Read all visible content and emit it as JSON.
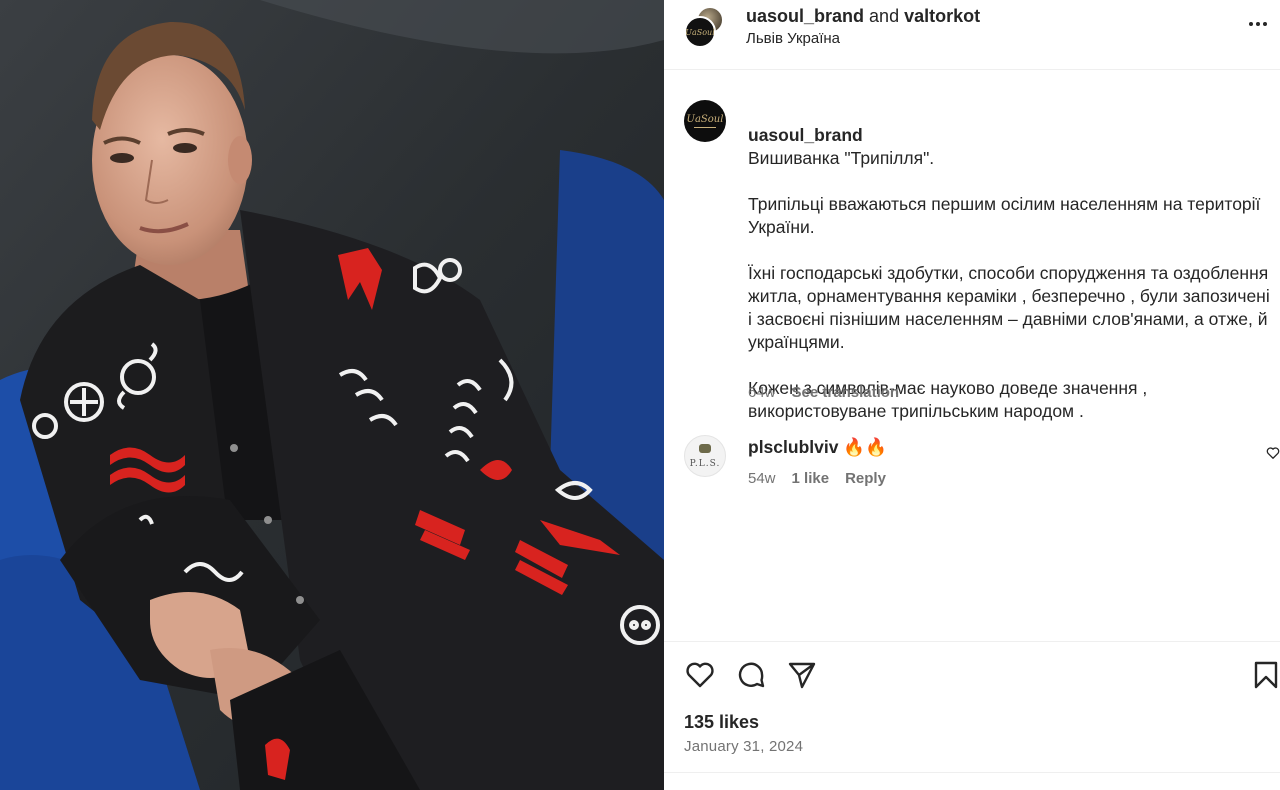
{
  "header": {
    "author": "uasoul_brand",
    "conjunction": "and",
    "collaborator": "valtorkot",
    "location": "Львів Україна",
    "more_icon": "more-horizontal-icon"
  },
  "caption": {
    "author": "uasoul_brand",
    "title": "Вишиванка \"Трипілля\".",
    "paragraphs": [
      "Трипільці вважаються першим осілим населенням на території України.",
      "Їхні господарські здобутки, способи спорудження та оздоблення житла, орнаментування кераміки , безперечно , були запозичені і засвоєні пізнішим населенням – давніми слов'янами, а отже, й українцями.",
      "Кожен з символів-має науково доведе значення , використовуване трипільським народом ."
    ],
    "age": "64w",
    "see_translation": "See translation",
    "avatar_logo": "UaSoul"
  },
  "comment": {
    "author": "plsclublviv",
    "text": "🔥🔥",
    "age": "54w",
    "likes": "1 like",
    "reply": "Reply",
    "avatar_logo": "P.L.S."
  },
  "actions": {
    "like_icon": "heart-icon",
    "comment_icon": "comment-icon",
    "share_icon": "send-icon",
    "save_icon": "bookmark-icon"
  },
  "stats": {
    "likes": "135 likes",
    "date": "January 31, 2024"
  },
  "colors": {
    "text": "#262626",
    "secondary": "#737373",
    "divider": "#efefef",
    "sofa_blue": "#1d4ea8",
    "jacket": "#1c1c1e",
    "ornament_red": "#d8231f"
  }
}
